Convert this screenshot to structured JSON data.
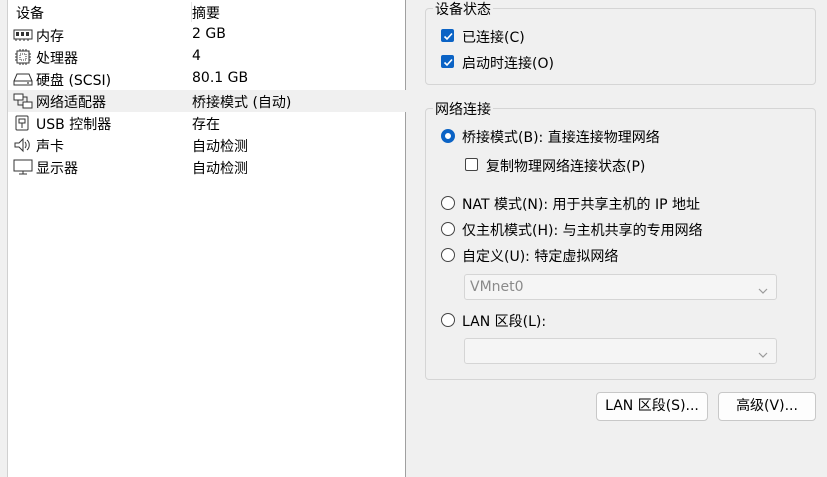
{
  "device_list": {
    "columns": {
      "device": "设备",
      "summary": "摘要"
    },
    "rows": [
      {
        "name": "内存",
        "summary": "2 GB",
        "icon": "memory-icon",
        "selected": false
      },
      {
        "name": "处理器",
        "summary": "4",
        "icon": "processor-icon",
        "selected": false
      },
      {
        "name": "硬盘 (SCSI)",
        "summary": "80.1 GB",
        "icon": "hard-disk-icon",
        "selected": false
      },
      {
        "name": "网络适配器",
        "summary": "桥接模式 (自动)",
        "icon": "network-adapter-icon",
        "selected": true
      },
      {
        "name": "USB 控制器",
        "summary": "存在",
        "icon": "usb-icon",
        "selected": false
      },
      {
        "name": "声卡",
        "summary": "自动检测",
        "icon": "speaker-icon",
        "selected": false
      },
      {
        "name": "显示器",
        "summary": "自动检测",
        "icon": "display-icon",
        "selected": false
      }
    ]
  },
  "device_status": {
    "legend": "设备状态",
    "connected": {
      "label": "已连接(C)",
      "checked": true
    },
    "connect_at_power_on": {
      "label": "启动时连接(O)",
      "checked": true
    }
  },
  "network_connection": {
    "legend": "网络连接",
    "bridged": {
      "label": "桥接模式(B): 直接连接物理网络",
      "selected": true
    },
    "replicate": {
      "label": "复制物理网络连接状态(P)",
      "checked": false
    },
    "nat": {
      "label": "NAT 模式(N): 用于共享主机的 IP 地址",
      "selected": false
    },
    "host_only": {
      "label": "仅主机模式(H): 与主机共享的专用网络",
      "selected": false
    },
    "custom": {
      "label": "自定义(U): 特定虚拟网络",
      "selected": false
    },
    "custom_select_value": "VMnet0",
    "lan_segment": {
      "label": "LAN 区段(L):",
      "selected": false
    },
    "lan_select_value": ""
  },
  "buttons": {
    "lan_segments": "LAN 区段(S)...",
    "advanced": "高级(V)..."
  },
  "colors": {
    "accent": "#0b63c5",
    "selected_row": "#f0f0f0",
    "panel_bg": "#f0f0f0"
  }
}
